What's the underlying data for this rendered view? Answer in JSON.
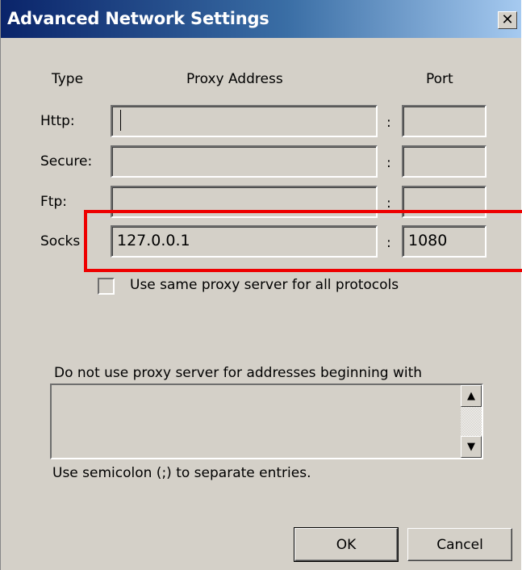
{
  "window": {
    "title": "Advanced Network Settings",
    "close_glyph": "✕"
  },
  "columns": {
    "type": "Type",
    "proxy_address": "Proxy Address",
    "port": "Port"
  },
  "rows": [
    {
      "label": "Http:",
      "address": "",
      "port": ""
    },
    {
      "label": "Secure:",
      "address": "",
      "port": ""
    },
    {
      "label": "Ftp:",
      "address": "",
      "port": ""
    },
    {
      "label": "Socks",
      "address": "127.0.0.1",
      "port": "1080"
    }
  ],
  "separator": ":",
  "same_proxy": {
    "label": "Use same proxy server for all protocols",
    "checked": false
  },
  "exclusions": {
    "label": "Do not use proxy server for addresses beginning with",
    "value": "",
    "hint": "Use semicolon (;) to separate entries."
  },
  "buttons": {
    "ok": "OK",
    "cancel": "Cancel"
  },
  "scroll": {
    "up": "▲",
    "down": "▼"
  },
  "colors": {
    "highlight": "#ee0000",
    "titlebar": "#0a246a",
    "dialog": "#d4d0c8"
  }
}
